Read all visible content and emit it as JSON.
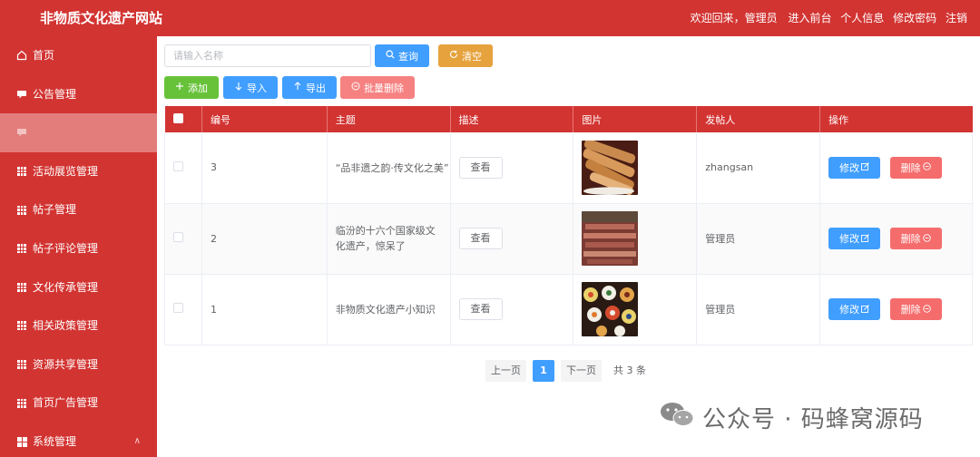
{
  "header": {
    "title": "非物质文化遗产网站",
    "welcome": "欢迎回来，管理员",
    "links": [
      "进入前台",
      "个人信息",
      "修改密码",
      "注销"
    ]
  },
  "sidebar": {
    "items": [
      {
        "label": "首页",
        "icon": "home-icon"
      },
      {
        "label": "公告管理",
        "icon": "chat-icon"
      },
      {
        "label": "",
        "icon": "chat-icon",
        "active": true
      },
      {
        "label": "活动展览管理",
        "icon": "grid-icon"
      },
      {
        "label": "帖子管理",
        "icon": "grid-icon"
      },
      {
        "label": "帖子评论管理",
        "icon": "grid-icon"
      },
      {
        "label": "文化传承管理",
        "icon": "grid-icon"
      },
      {
        "label": "相关政策管理",
        "icon": "grid-icon"
      },
      {
        "label": "资源共享管理",
        "icon": "grid-icon"
      },
      {
        "label": "首页广告管理",
        "icon": "grid-icon"
      },
      {
        "label": "系统管理",
        "icon": "grid4-icon",
        "caret": "∧"
      }
    ]
  },
  "search": {
    "placeholder": "请输入名称",
    "query_label": "查询",
    "reset_label": "清空"
  },
  "toolbar": {
    "add_label": "添加",
    "import_label": "导入",
    "export_label": "导出",
    "batch_delete_label": "批量删除"
  },
  "table": {
    "columns": [
      "编号",
      "主题",
      "描述",
      "图片",
      "发帖人",
      "操作"
    ],
    "view_label": "查看",
    "edit_label": "修改",
    "delete_label": "删除",
    "rows": [
      {
        "id": "3",
        "topic": "“品非遗之韵·传文化之美”",
        "poster": "zhangsan",
        "image": "food-rolls-image"
      },
      {
        "id": "2",
        "topic": "临汾的十六个国家级文化遗产，惊呆了",
        "poster": "管理员",
        "image": "crowd-image"
      },
      {
        "id": "1",
        "topic": "非物质文化遗产小知识",
        "poster": "管理员",
        "image": "sushi-image"
      }
    ]
  },
  "pagination": {
    "prev": "上一页",
    "current": "1",
    "next": "下一页",
    "total": "共 3 条"
  },
  "watermark": {
    "text": "公众号 · 码蜂窝源码"
  },
  "colors": {
    "primary_red": "#d23432",
    "active_menu": "#e37d7b",
    "blue": "#409eff",
    "orange": "#e6a23c",
    "green": "#67c23a",
    "danger": "#f56c6c"
  }
}
